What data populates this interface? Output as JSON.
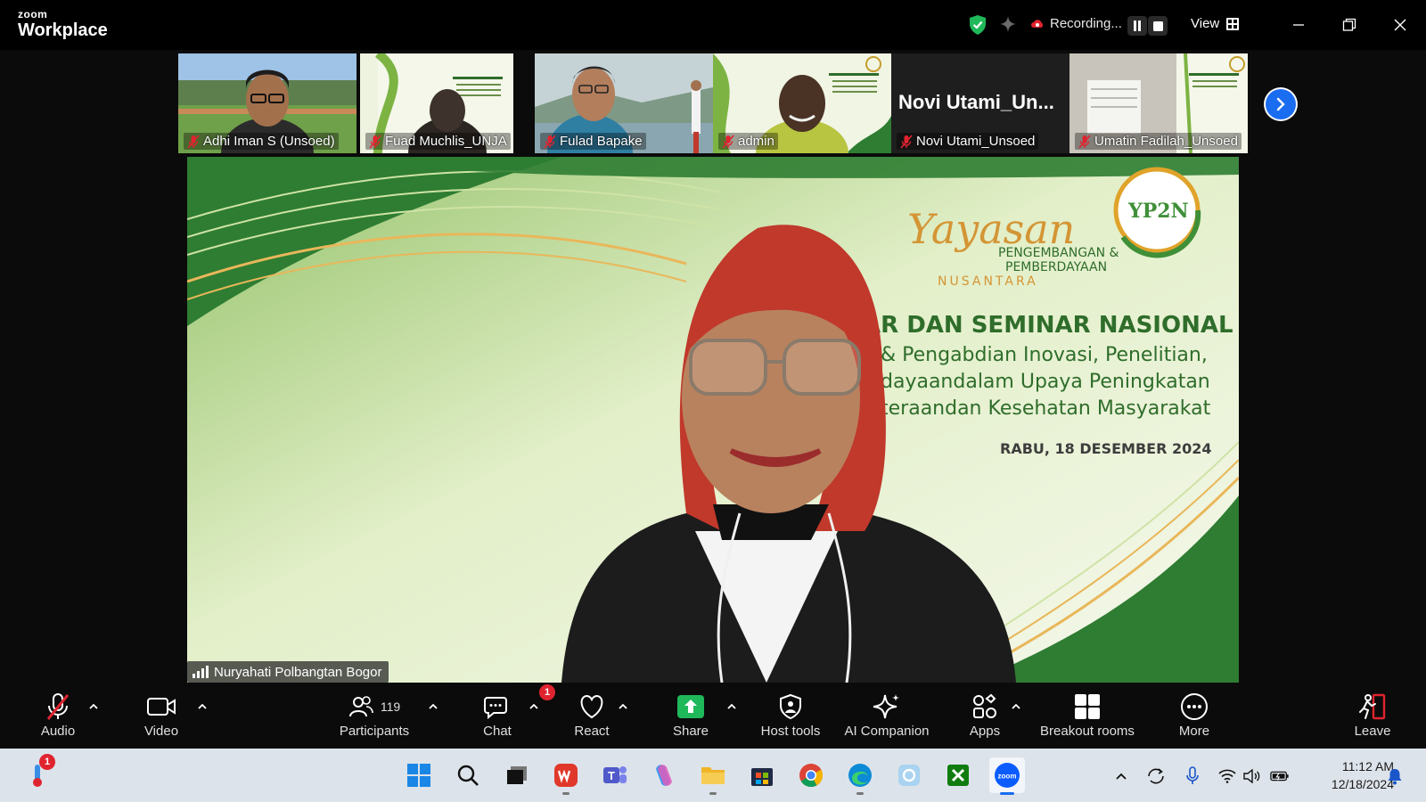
{
  "app": {
    "brand_small": "zoom",
    "brand_large": "Workplace",
    "recording_label": "Recording...",
    "view_label": "View"
  },
  "thumbnails": [
    {
      "name": "Adhi Iman S (Unsoed)",
      "muted": true
    },
    {
      "name": "Fuad Muchlis_UNJA",
      "muted": true
    },
    {
      "name": "Fulad Bapake",
      "muted": true
    },
    {
      "name": "admin",
      "muted": true
    },
    {
      "name": "Novi Utami_Unsoed",
      "display_title": "Novi  Utami_Un...",
      "muted": true
    },
    {
      "name": "Umatin Fadilah_Unsoed",
      "muted": true
    }
  ],
  "speaker": {
    "name": "Nuryahati Polbangtan Bogor"
  },
  "slide": {
    "logo": "YP2N",
    "org_script": "Yayasan",
    "org_line1": "PENGEMBANGAN &",
    "org_line2": "PEMBERDAYAAN",
    "org_line3": "NUSANTARA",
    "title": "AR DAN SEMINAR NASIONAL",
    "line1": "& Pengabdian Inovasi, Penelitian,",
    "line2": "dayaandalam Upaya Peningkatan",
    "line3": "teraandan Kesehatan Masyarakat",
    "date": "RABU, 18 DESEMBER 2024"
  },
  "toolbar": {
    "audio": "Audio",
    "video": "Video",
    "participants": "Participants",
    "participants_count": "119",
    "chat": "Chat",
    "chat_badge": "1",
    "react": "React",
    "share": "Share",
    "host_tools": "Host tools",
    "ai_companion": "AI Companion",
    "apps": "Apps",
    "breakout_rooms": "Breakout rooms",
    "more": "More",
    "leave": "Leave"
  },
  "taskbar": {
    "weather_badge": "1",
    "time": "11:12 AM",
    "date": "12/18/2024"
  },
  "colors": {
    "accent_blue": "#1a6cf0",
    "muted_red": "#e0242f",
    "share_green": "#1fb85a",
    "slide_green": "#2f6d2b"
  }
}
